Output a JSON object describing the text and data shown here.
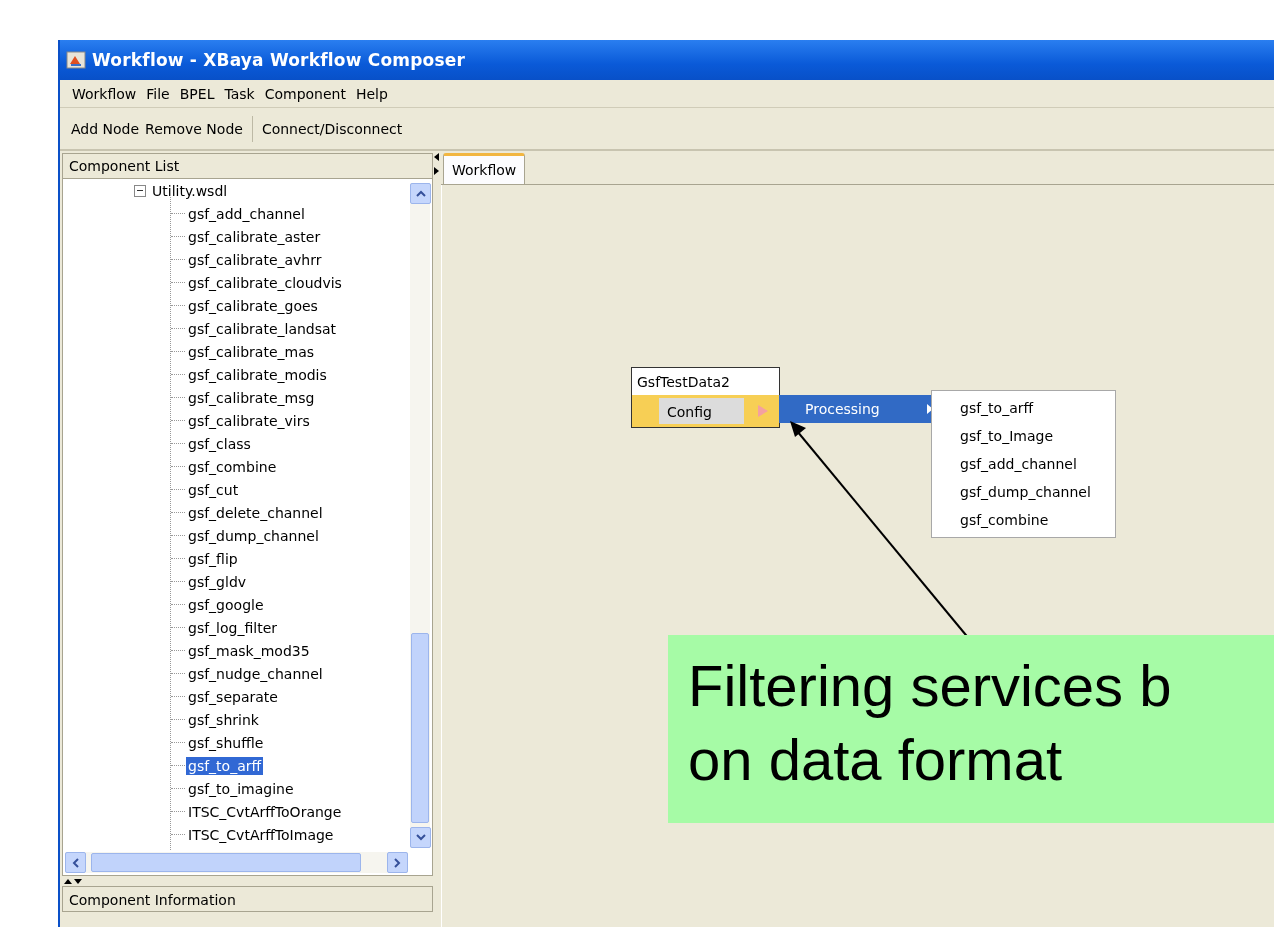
{
  "window": {
    "title": "Workflow - XBaya Workflow Composer"
  },
  "menu_bar": [
    "Workflow",
    "File",
    "BPEL",
    "Task",
    "Component",
    "Help"
  ],
  "toolbar": [
    [
      "Add Node",
      "Remove Node"
    ],
    [
      "Connect/Disconnect"
    ]
  ],
  "component_list": {
    "header": "Component List",
    "tree": [
      {
        "label": "Utility.wsdl",
        "expanded": true,
        "selected": false,
        "children": [
          {
            "label": "gsf_add_channel",
            "selected": false
          },
          {
            "label": "gsf_calibrate_aster",
            "selected": false
          },
          {
            "label": "gsf_calibrate_avhrr",
            "selected": false
          },
          {
            "label": "gsf_calibrate_cloudvis",
            "selected": false
          },
          {
            "label": "gsf_calibrate_goes",
            "selected": false
          },
          {
            "label": "gsf_calibrate_landsat",
            "selected": false
          },
          {
            "label": "gsf_calibrate_mas",
            "selected": false
          },
          {
            "label": "gsf_calibrate_modis",
            "selected": false
          },
          {
            "label": "gsf_calibrate_msg",
            "selected": false
          },
          {
            "label": "gsf_calibrate_virs",
            "selected": false
          },
          {
            "label": "gsf_class",
            "selected": false
          },
          {
            "label": "gsf_combine",
            "selected": false
          },
          {
            "label": "gsf_cut",
            "selected": false
          },
          {
            "label": "gsf_delete_channel",
            "selected": false
          },
          {
            "label": "gsf_dump_channel",
            "selected": false
          },
          {
            "label": "gsf_flip",
            "selected": false
          },
          {
            "label": "gsf_gldv",
            "selected": false
          },
          {
            "label": "gsf_google",
            "selected": false
          },
          {
            "label": "gsf_log_filter",
            "selected": false
          },
          {
            "label": "gsf_mask_mod35",
            "selected": false
          },
          {
            "label": "gsf_nudge_channel",
            "selected": false
          },
          {
            "label": "gsf_separate",
            "selected": false
          },
          {
            "label": "gsf_shrink",
            "selected": false
          },
          {
            "label": "gsf_shuffle",
            "selected": false
          },
          {
            "label": "gsf_to_arff",
            "selected": true
          },
          {
            "label": "gsf_to_imagine",
            "selected": false
          },
          {
            "label": "ITSC_CvtArffToOrange",
            "selected": false
          },
          {
            "label": "ITSC_CvtArffToImage",
            "selected": false
          }
        ]
      }
    ]
  },
  "component_information": {
    "header": "Component Information"
  },
  "tabs": [
    {
      "label": "Workflow",
      "selected": true
    }
  ],
  "canvas": {
    "node": {
      "title": "GsfTestData2",
      "port": "Config"
    },
    "context_menu": [
      {
        "label": "Processing",
        "selected": true
      }
    ],
    "submenu": [
      "gsf_to_arff",
      "gsf_to_Image",
      "gsf_add_channel",
      "gsf_dump_channel",
      "gsf_combine"
    ]
  },
  "callout": {
    "lines": [
      "Filtering services b",
      "on data format"
    ]
  }
}
